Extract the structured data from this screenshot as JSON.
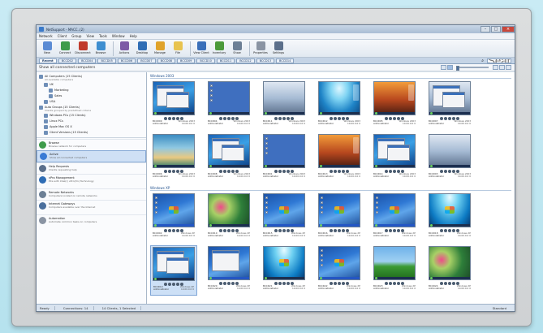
{
  "window": {
    "title": "NetSupport - MACC..(2)"
  },
  "menu": [
    "Network",
    "Client",
    "Group",
    "View",
    "Tools",
    "Window",
    "Help"
  ],
  "toolbar": [
    {
      "label": "New",
      "icon": "new-icon",
      "color": "#5b8bd4"
    },
    {
      "label": "Connect",
      "icon": "connect-icon",
      "color": "#3e9b4a"
    },
    {
      "label": "Disconnect",
      "icon": "disconnect-icon",
      "color": "#c0392b"
    },
    {
      "label": "Browse",
      "icon": "browse-icon",
      "color": "#3e8ed0"
    },
    {
      "label": "Actions",
      "icon": "actions-icon",
      "color": "#7d5ba6"
    },
    {
      "label": "Desktop",
      "icon": "desktop-icon",
      "color": "#2f6db5"
    },
    {
      "label": "Manage",
      "icon": "manage-icon",
      "color": "#e0a32b"
    },
    {
      "label": "File",
      "icon": "file-icon",
      "color": "#e8c34f"
    },
    {
      "label": "View Client",
      "icon": "view-client-icon",
      "color": "#3a6fb9"
    },
    {
      "label": "Inventory",
      "icon": "inventory-icon",
      "color": "#4c9a3a"
    },
    {
      "label": "Show",
      "icon": "show-icon",
      "color": "#6c7f95"
    },
    {
      "label": "Properties",
      "icon": "properties-icon",
      "color": "#8a94a3"
    },
    {
      "label": "Settings",
      "icon": "settings-icon",
      "color": "#5b6f8b"
    }
  ],
  "tabs": [
    "Recent",
    "BCCD02",
    "BCCD04",
    "BCCD05",
    "BCCD06",
    "BCCD07",
    "BCCD08",
    "BCCD09",
    "BCCD10",
    "BCCD11",
    "BCCD12",
    "BCCD13",
    "BCCD14"
  ],
  "search_placeholder": "Search",
  "subheader": "Show all connected computers",
  "sidebar": {
    "tree": [
      {
        "label": "All Computers (15 Clients)",
        "sub": "All available computers"
      },
      {
        "label": "UK",
        "sub": ""
      },
      {
        "label": "Marketing",
        "sub": ""
      },
      {
        "label": "Sales",
        "sub": ""
      },
      {
        "label": "USA",
        "sub": ""
      },
      {
        "label": "Auto Groups (15 Clients)",
        "sub": "Clients grouped by predefined criteria"
      },
      {
        "label": "Windows PCs (15 Clients)",
        "sub": ""
      },
      {
        "label": "Linux PCs",
        "sub": ""
      },
      {
        "label": "Apple Mac OS X",
        "sub": ""
      },
      {
        "label": "Client Versions (15 Clients)",
        "sub": ""
      }
    ],
    "nav": [
      {
        "label": "Browse",
        "sub": "Browse network for computers",
        "color": "#3e9b4a"
      },
      {
        "label": "Active",
        "sub": "Show all connected computers",
        "color": "#3a7bd5"
      },
      {
        "label": "Help Requests",
        "sub": "Clients requesting help",
        "color": "#5b6f8b"
      },
      {
        "label": "vPro Management",
        "sub": "PCs with Intel(r) vPro(tm) Technology",
        "color": "#2f6db5"
      },
      {
        "label": "Remote Networks",
        "sub": "Computers located on remote networks",
        "color": "#6c7f95"
      },
      {
        "label": "Internet Gateways",
        "sub": "Computers available over the Internet",
        "color": "#4a6f9d"
      },
      {
        "label": "Automation",
        "sub": "Automate common tasks on computers",
        "color": "#8a94a3"
      }
    ]
  },
  "groups": [
    {
      "label": "Windows 2003",
      "rows": [
        [
          {
            "name": "BCCD09",
            "os": "Windows 2003",
            "user": "Administrator",
            "version": "10.00.0.0 0",
            "style": "vista-windows"
          },
          {
            "name": "BCCD04",
            "os": "Windows 2003",
            "user": "Administrator",
            "version": "10.00.0.0 0",
            "style": "blue"
          },
          {
            "name": "BCCD11",
            "os": "Windows 2003",
            "user": "Administrator",
            "version": "10.00.0.0 0",
            "style": "winter"
          },
          {
            "name": "BCCD12",
            "os": "Windows 2003",
            "user": "Administrator",
            "version": "10.00.0.0 0",
            "style": "aurora"
          },
          {
            "name": "BCCD05",
            "os": "Windows 2003",
            "user": "Administrator",
            "version": "10.00.0.0 0",
            "style": "orange"
          },
          {
            "name": "BCCD07",
            "os": "Windows 2003",
            "user": "Administrator",
            "version": "10.00.0.0 0",
            "style": "winter-windows"
          }
        ],
        [
          {
            "name": "BCCD06",
            "os": "Windows 2003",
            "user": "Administrator",
            "version": "10.00.0.0 0",
            "style": "tropical"
          },
          {
            "name": "BCCD08",
            "os": "Windows 2003",
            "user": "Administrator",
            "version": "10.00.0.0 0",
            "style": "vista-windows"
          },
          {
            "name": "BCCD01",
            "os": "Windows 2003",
            "user": "Administrator",
            "version": "10.00.0.0 0",
            "style": "blue"
          },
          {
            "name": "BCCD13",
            "os": "Windows 2003",
            "user": "Administrator",
            "version": "10.00.0.0 0",
            "style": "orange"
          },
          {
            "name": "BCCD14",
            "os": "Windows 2003",
            "user": "Administrator",
            "version": "10.00.0.0 0",
            "style": "vista-windows"
          },
          {
            "name": "BCCD03",
            "os": "Windows 2003",
            "user": "Administrator",
            "version": "10.00.0.0 0",
            "style": "winter"
          }
        ]
      ]
    },
    {
      "label": "Windows XP",
      "rows": [
        [
          {
            "name": "BCCD02",
            "os": "Windows XP",
            "user": "Administrator",
            "version": "10.00.0.0 0",
            "style": "xp"
          },
          {
            "name": "BCCD10",
            "os": "Windows XP",
            "user": "Administrator",
            "version": "10.00.0.0 0",
            "style": "flowers"
          },
          {
            "name": "BCCD15",
            "os": "Windows XP",
            "user": "Administrator",
            "version": "10.00.0.0 0",
            "style": "xp"
          },
          {
            "name": "BCCD16",
            "os": "Windows XP",
            "user": "Administrator",
            "version": "10.00.0.0 0",
            "style": "xp-icons"
          },
          {
            "name": "BCCD17",
            "os": "Windows XP",
            "user": "Administrator",
            "version": "10.00.0.0 0",
            "style": "xp"
          },
          {
            "name": "BCCD18",
            "os": "Windows XP",
            "user": "Administrator",
            "version": "10.00.0.0 0",
            "style": "ocean"
          }
        ],
        [
          {
            "name": "BCCD19",
            "os": "Windows XP",
            "user": "Administrator",
            "version": "10.00.0.0 0",
            "style": "vista-windows"
          },
          {
            "name": "BCCD20",
            "os": "Windows XP",
            "user": "Administrator",
            "version": "10.00.0.0 0",
            "style": "xp-window"
          },
          {
            "name": "BCCD21",
            "os": "Windows XP",
            "user": "Administrator",
            "version": "10.00.0.0 0",
            "style": "ocean"
          },
          {
            "name": "BCCD22",
            "os": "Windows XP",
            "user": "Administrator",
            "version": "10.00.0.0 0",
            "style": "xp-icons"
          },
          {
            "name": "BCCD23",
            "os": "Windows XP",
            "user": "Administrator",
            "version": "10.00.0.0 0",
            "style": "grass"
          },
          {
            "name": "BCCD24",
            "os": "Windows XP",
            "user": "Administrator",
            "version": "10.00.0.0 0",
            "style": "flowers"
          }
        ]
      ]
    }
  ],
  "status": {
    "ready": "Ready",
    "connections": "Connections: 14",
    "clients": "14 Clients, 1 Selected",
    "mode": "Standard"
  }
}
